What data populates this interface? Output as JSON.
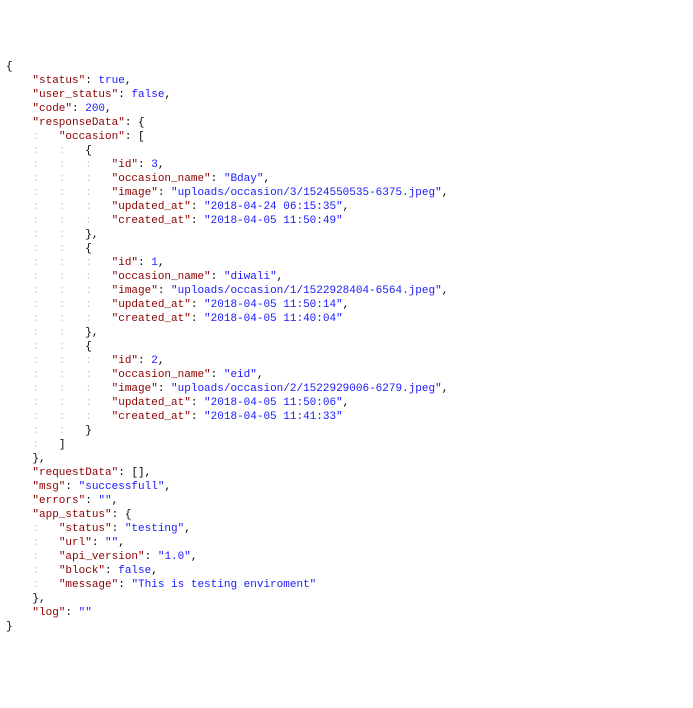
{
  "lines": [
    [
      [
        "pun",
        "{"
      ]
    ],
    [
      [
        "pun",
        "    "
      ],
      [
        "key",
        "\"status\""
      ],
      [
        "col",
        ": "
      ],
      [
        "lit",
        "true"
      ],
      [
        "pun",
        ","
      ]
    ],
    [
      [
        "pun",
        "    "
      ],
      [
        "key",
        "\"user_status\""
      ],
      [
        "col",
        ": "
      ],
      [
        "lit",
        "false"
      ],
      [
        "pun",
        ","
      ]
    ],
    [
      [
        "pun",
        "    "
      ],
      [
        "key",
        "\"code\""
      ],
      [
        "col",
        ": "
      ],
      [
        "lit",
        "200"
      ],
      [
        "pun",
        ","
      ]
    ],
    [
      [
        "pun",
        "    "
      ],
      [
        "key",
        "\"responseData\""
      ],
      [
        "col",
        ": "
      ],
      [
        "pun",
        "{"
      ]
    ],
    [
      [
        "faint",
        "    :   "
      ],
      [
        "key",
        "\"occasion\""
      ],
      [
        "col",
        ": "
      ],
      [
        "pun",
        "["
      ]
    ],
    [
      [
        "faint",
        "    :   :   "
      ],
      [
        "pun",
        "{"
      ]
    ],
    [
      [
        "faint",
        "    :   :   :   "
      ],
      [
        "key",
        "\"id\""
      ],
      [
        "col",
        ": "
      ],
      [
        "lit",
        "3"
      ],
      [
        "pun",
        ","
      ]
    ],
    [
      [
        "faint",
        "    :   :   :   "
      ],
      [
        "key",
        "\"occasion_name\""
      ],
      [
        "col",
        ": "
      ],
      [
        "str",
        "\"Bday\""
      ],
      [
        "pun",
        ","
      ]
    ],
    [
      [
        "faint",
        "    :   :   :   "
      ],
      [
        "key",
        "\"image\""
      ],
      [
        "col",
        ": "
      ],
      [
        "str",
        "\"uploads/occasion/3/1524550535-6375.jpeg\""
      ],
      [
        "pun",
        ","
      ]
    ],
    [
      [
        "faint",
        "    :   :   :   "
      ],
      [
        "key",
        "\"updated_at\""
      ],
      [
        "col",
        ": "
      ],
      [
        "str",
        "\"2018-04-24 06:15:35\""
      ],
      [
        "pun",
        ","
      ]
    ],
    [
      [
        "faint",
        "    :   :   :   "
      ],
      [
        "key",
        "\"created_at\""
      ],
      [
        "col",
        ": "
      ],
      [
        "str",
        "\"2018-04-05 11:50:49\""
      ]
    ],
    [
      [
        "faint",
        "    :   :   "
      ],
      [
        "pun",
        "},"
      ]
    ],
    [
      [
        "faint",
        "    :   :   "
      ],
      [
        "pun",
        "{"
      ]
    ],
    [
      [
        "faint",
        "    :   :   :   "
      ],
      [
        "key",
        "\"id\""
      ],
      [
        "col",
        ": "
      ],
      [
        "lit",
        "1"
      ],
      [
        "pun",
        ","
      ]
    ],
    [
      [
        "faint",
        "    :   :   :   "
      ],
      [
        "key",
        "\"occasion_name\""
      ],
      [
        "col",
        ": "
      ],
      [
        "str",
        "\"diwali\""
      ],
      [
        "pun",
        ","
      ]
    ],
    [
      [
        "faint",
        "    :   :   :   "
      ],
      [
        "key",
        "\"image\""
      ],
      [
        "col",
        ": "
      ],
      [
        "str",
        "\"uploads/occasion/1/1522928404-6564.jpeg\""
      ],
      [
        "pun",
        ","
      ]
    ],
    [
      [
        "faint",
        "    :   :   :   "
      ],
      [
        "key",
        "\"updated_at\""
      ],
      [
        "col",
        ": "
      ],
      [
        "str",
        "\"2018-04-05 11:50:14\""
      ],
      [
        "pun",
        ","
      ]
    ],
    [
      [
        "faint",
        "    :   :   :   "
      ],
      [
        "key",
        "\"created_at\""
      ],
      [
        "col",
        ": "
      ],
      [
        "str",
        "\"2018-04-05 11:40:04\""
      ]
    ],
    [
      [
        "faint",
        "    :   :   "
      ],
      [
        "pun",
        "},"
      ]
    ],
    [
      [
        "faint",
        "    :   :   "
      ],
      [
        "pun",
        "{"
      ]
    ],
    [
      [
        "faint",
        "    :   :   :   "
      ],
      [
        "key",
        "\"id\""
      ],
      [
        "col",
        ": "
      ],
      [
        "lit",
        "2"
      ],
      [
        "pun",
        ","
      ]
    ],
    [
      [
        "faint",
        "    :   :   :   "
      ],
      [
        "key",
        "\"occasion_name\""
      ],
      [
        "col",
        ": "
      ],
      [
        "str",
        "\"eid\""
      ],
      [
        "pun",
        ","
      ]
    ],
    [
      [
        "faint",
        "    :   :   :   "
      ],
      [
        "key",
        "\"image\""
      ],
      [
        "col",
        ": "
      ],
      [
        "str",
        "\"uploads/occasion/2/1522929006-6279.jpeg\""
      ],
      [
        "pun",
        ","
      ]
    ],
    [
      [
        "faint",
        "    :   :   :   "
      ],
      [
        "key",
        "\"updated_at\""
      ],
      [
        "col",
        ": "
      ],
      [
        "str",
        "\"2018-04-05 11:50:06\""
      ],
      [
        "pun",
        ","
      ]
    ],
    [
      [
        "faint",
        "    :   :   :   "
      ],
      [
        "key",
        "\"created_at\""
      ],
      [
        "col",
        ": "
      ],
      [
        "str",
        "\"2018-04-05 11:41:33\""
      ]
    ],
    [
      [
        "faint",
        "    :   :   "
      ],
      [
        "pun",
        "}"
      ]
    ],
    [
      [
        "faint",
        "    :   "
      ],
      [
        "pun",
        "]"
      ]
    ],
    [
      [
        "pun",
        "    },"
      ]
    ],
    [
      [
        "pun",
        "    "
      ],
      [
        "key",
        "\"requestData\""
      ],
      [
        "col",
        ": "
      ],
      [
        "pun",
        "[],"
      ]
    ],
    [
      [
        "pun",
        "    "
      ],
      [
        "key",
        "\"msg\""
      ],
      [
        "col",
        ": "
      ],
      [
        "str",
        "\"successfull\""
      ],
      [
        "pun",
        ","
      ]
    ],
    [
      [
        "pun",
        "    "
      ],
      [
        "key",
        "\"errors\""
      ],
      [
        "col",
        ": "
      ],
      [
        "str",
        "\"\""
      ],
      [
        "pun",
        ","
      ]
    ],
    [
      [
        "pun",
        "    "
      ],
      [
        "key",
        "\"app_status\""
      ],
      [
        "col",
        ": "
      ],
      [
        "pun",
        "{"
      ]
    ],
    [
      [
        "faint",
        "    :   "
      ],
      [
        "key",
        "\"status\""
      ],
      [
        "col",
        ": "
      ],
      [
        "str",
        "\"testing\""
      ],
      [
        "pun",
        ","
      ]
    ],
    [
      [
        "faint",
        "    :   "
      ],
      [
        "key",
        "\"url\""
      ],
      [
        "col",
        ": "
      ],
      [
        "str",
        "\"\""
      ],
      [
        "pun",
        ","
      ]
    ],
    [
      [
        "faint",
        "    :   "
      ],
      [
        "key",
        "\"api_version\""
      ],
      [
        "col",
        ": "
      ],
      [
        "str",
        "\"1.0\""
      ],
      [
        "pun",
        ","
      ]
    ],
    [
      [
        "faint",
        "    :   "
      ],
      [
        "key",
        "\"block\""
      ],
      [
        "col",
        ": "
      ],
      [
        "lit",
        "false"
      ],
      [
        "pun",
        ","
      ]
    ],
    [
      [
        "faint",
        "    :   "
      ],
      [
        "key",
        "\"message\""
      ],
      [
        "col",
        ": "
      ],
      [
        "str",
        "\"This is testing enviroment\""
      ]
    ],
    [
      [
        "pun",
        "    },"
      ]
    ],
    [
      [
        "pun",
        "    "
      ],
      [
        "key",
        "\"log\""
      ],
      [
        "col",
        ": "
      ],
      [
        "str",
        "\"\""
      ]
    ],
    [
      [
        "pun",
        "}"
      ]
    ]
  ]
}
